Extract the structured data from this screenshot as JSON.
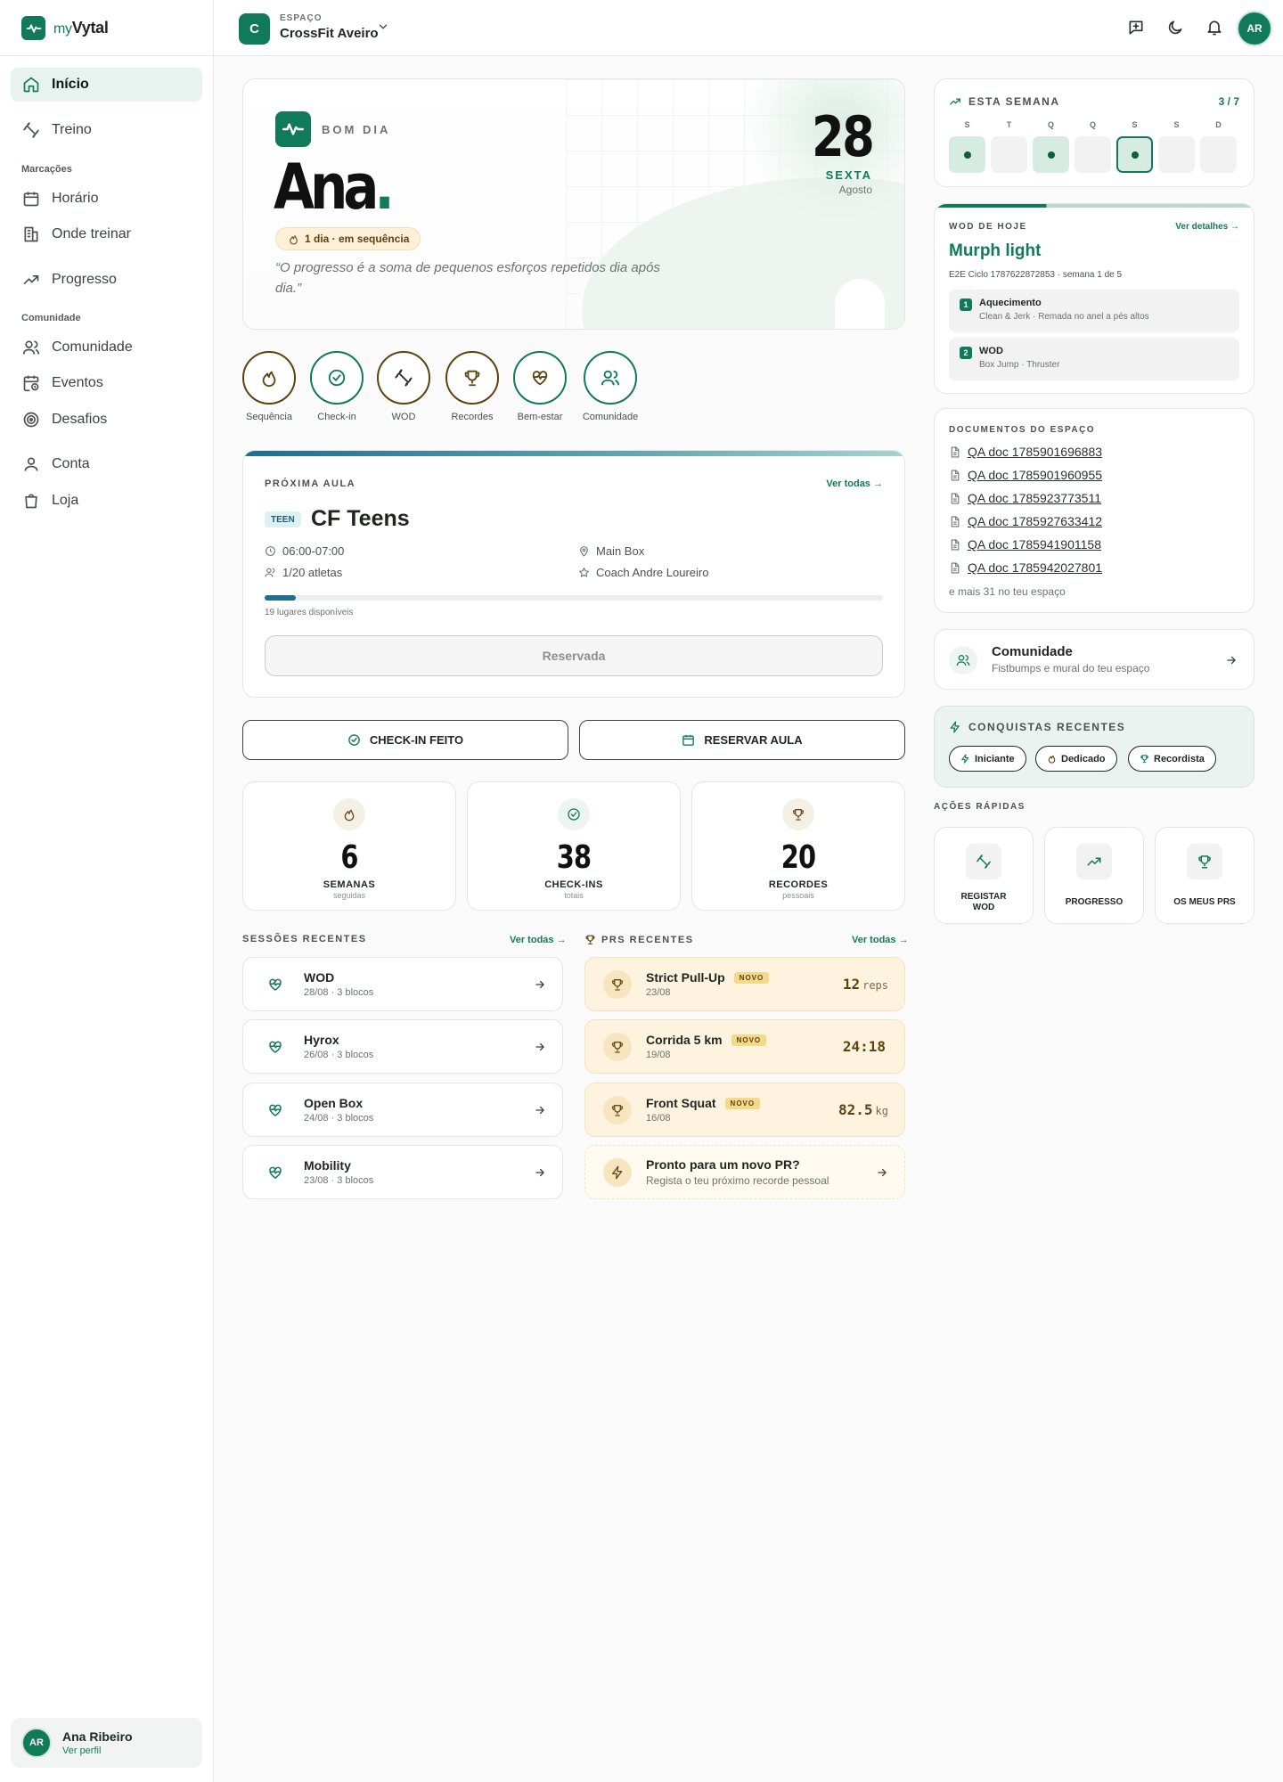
{
  "app": {
    "brand_prefix": "my",
    "brand_name": "Vytal"
  },
  "sidebar": {
    "items": [
      {
        "label": "Início",
        "icon": "home-icon",
        "active": true
      },
      {
        "label": "Treino",
        "icon": "dumbbell-icon"
      },
      {
        "label": "Horário",
        "icon": "calendar-icon"
      },
      {
        "label": "Onde treinar",
        "icon": "building-icon"
      },
      {
        "label": "Progresso",
        "icon": "trending-up-icon"
      },
      {
        "label": "Comunidade",
        "icon": "users-icon"
      },
      {
        "label": "Eventos",
        "icon": "calendar-clock-icon"
      },
      {
        "label": "Desafios",
        "icon": "target-icon"
      },
      {
        "label": "Conta",
        "icon": "user-icon"
      },
      {
        "label": "Loja",
        "icon": "shopping-bag-icon"
      }
    ],
    "groups": {
      "marcacoes": "Marcações",
      "comunidade": "Comunidade"
    },
    "profile": {
      "initials": "AR",
      "name": "Ana Ribeiro",
      "link": "Ver perfil"
    }
  },
  "topbar": {
    "workspace_initial": "C",
    "workspace_label": "ESPAÇO",
    "workspace_name": "CrossFit Aveiro",
    "avatar_initials": "AR",
    "icons": [
      "message-plus-icon",
      "moon-icon",
      "bell-icon"
    ]
  },
  "hero": {
    "greeting": "BOM DIA",
    "name": "Ana",
    "name_dot": ".",
    "streak": "1 dia · em sequência",
    "quote": "“O progresso é a soma de pequenos esforços repetidos dia após dia.”",
    "day": "28",
    "weekday": "SEXTA",
    "month": "Agosto"
  },
  "quick_circles": [
    {
      "label": "Sequência",
      "icon": "flame-icon"
    },
    {
      "label": "Check-in",
      "icon": "check-circle-icon"
    },
    {
      "label": "WOD",
      "icon": "dumbbell-icon"
    },
    {
      "label": "Recordes",
      "icon": "trophy-icon"
    },
    {
      "label": "Bem-estar",
      "icon": "heart-pulse-icon"
    },
    {
      "label": "Comunidade",
      "icon": "users-icon"
    }
  ],
  "next_class": {
    "section": "PRÓXIMA AULA",
    "see_all": "Ver todas",
    "tag": "TEEN",
    "name": "CF Teens",
    "time": "06:00-07:00",
    "athletes": "1/20 atletas",
    "location": "Main Box",
    "coach": "Coach Andre Loureiro",
    "fill_fraction": 0.05,
    "spots": "19 lugares disponíveis",
    "button": "Reservada"
  },
  "actions": {
    "checkin": "CHECK-IN FEITO",
    "reserve": "RESERVAR AULA"
  },
  "stats": [
    {
      "value": "6",
      "label": "SEMANAS",
      "sub": "seguidas",
      "icon": "flame-icon"
    },
    {
      "value": "38",
      "label": "CHECK-INS",
      "sub": "totais",
      "icon": "check-circle-icon"
    },
    {
      "value": "20",
      "label": "RECORDES",
      "sub": "pessoais",
      "icon": "trophy-icon"
    }
  ],
  "sessions": {
    "title": "SESSÕES RECENTES",
    "see_all": "Ver todas",
    "items": [
      {
        "title": "WOD",
        "sub": "28/08 · 3 blocos"
      },
      {
        "title": "Hyrox",
        "sub": "26/08 · 3 blocos"
      },
      {
        "title": "Open Box",
        "sub": "24/08 · 3 blocos"
      },
      {
        "title": "Mobility",
        "sub": "23/08 · 3 blocos"
      }
    ]
  },
  "prs": {
    "title": "PRS RECENTES",
    "see_all": "Ver todas",
    "badge": "NOVO",
    "items": [
      {
        "title": "Strict Pull-Up",
        "date": "23/08",
        "value": "12",
        "unit": "reps"
      },
      {
        "title": "Corrida 5 km",
        "date": "19/08",
        "value": "24:18",
        "unit": ""
      },
      {
        "title": "Front Squat",
        "date": "16/08",
        "value": "82.5",
        "unit": "kg"
      }
    ],
    "cta_title": "Pronto para um novo PR?",
    "cta_sub": "Regista o teu próximo recorde pessoal"
  },
  "week": {
    "title": "ESTA SEMANA",
    "count": "3 / 7",
    "days": [
      "S",
      "T",
      "Q",
      "Q",
      "S",
      "S",
      "D"
    ],
    "done": [
      true,
      false,
      true,
      false,
      true,
      false,
      false
    ],
    "today_index": 4
  },
  "wod": {
    "label": "WOD DE HOJE",
    "details": "Ver detalhes",
    "title": "Murph light",
    "cycle": "E2E Ciclo 1787622872853 · semana 1 de 5",
    "blocks": [
      {
        "n": "1",
        "title": "Aquecimento",
        "sub": "Clean & Jerk · Remada no anel a pés altos"
      },
      {
        "n": "2",
        "title": "WOD",
        "sub": "Box Jump · Thruster"
      }
    ]
  },
  "docs": {
    "title": "DOCUMENTOS DO ESPAÇO",
    "items": [
      "QA doc 1785901696883",
      "QA doc 1785901960955",
      "QA doc 1785923773511",
      "QA doc 1785927633412",
      "QA doc 1785941901158",
      "QA doc 1785942027801"
    ],
    "more": "e mais 31 no teu espaço"
  },
  "community": {
    "title": "Comunidade",
    "sub": "Fistbumps e mural do teu espaço"
  },
  "achievements": {
    "title": "CONQUISTAS RECENTES",
    "chips": [
      {
        "label": "Iniciante",
        "icon": "zap-icon"
      },
      {
        "label": "Dedicado",
        "icon": "flame-icon"
      },
      {
        "label": "Recordista",
        "icon": "trophy-icon"
      }
    ]
  },
  "quick_actions": {
    "title": "AÇÕES RÁPIDAS",
    "items": [
      {
        "label": "REGISTAR WOD",
        "icon": "dumbbell-icon"
      },
      {
        "label": "PROGRESSO",
        "icon": "trending-up-icon"
      },
      {
        "label": "OS MEUS PRS",
        "icon": "trophy-icon"
      }
    ]
  },
  "colors": {
    "accent": "#117a58",
    "gold": "#5e4210",
    "teal": "#1d6f8c",
    "pr_bg": "#fdf3df"
  }
}
